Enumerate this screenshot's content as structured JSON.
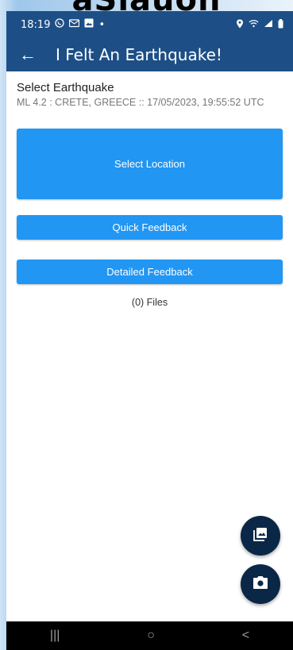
{
  "overlay_text": "aSiauon",
  "status_bar": {
    "time": "18:19",
    "left_icons": [
      "whatsapp-icon",
      "message-icon",
      "image-icon",
      "dot"
    ],
    "right_icons": [
      "location-icon",
      "wifi-icon",
      "signal-icon",
      "battery-icon"
    ]
  },
  "app_bar": {
    "back_label": "←",
    "title": "I Felt An Earthquake!"
  },
  "earthquake": {
    "label": "Select Earthquake",
    "details": "ML 4.2 : CRETE, GREECE :: 17/05/2023, 19:55:52 UTC"
  },
  "buttons": {
    "select_location": "Select Location",
    "quick_feedback": "Quick Feedback",
    "detailed_feedback": "Detailed Feedback"
  },
  "files_text": "(0) Files",
  "fabs": [
    "gallery-icon",
    "camera-icon"
  ],
  "nav_bar": {
    "recent": "|||",
    "home": "○",
    "back": "<"
  },
  "colors": {
    "primary_dark": "#1d4f86",
    "button_blue": "#2196f3",
    "fab_navy": "#0b2747"
  }
}
